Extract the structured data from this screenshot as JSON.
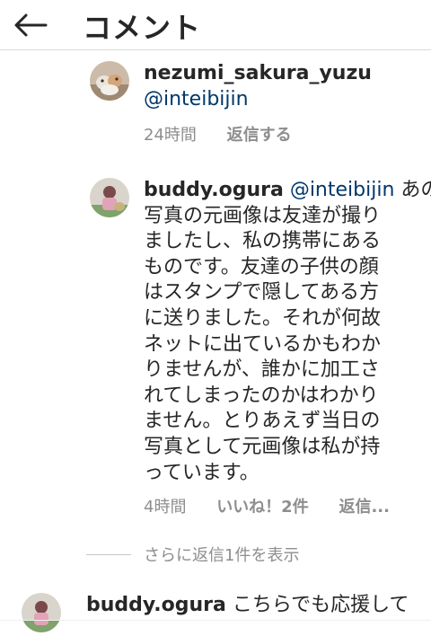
{
  "header": {
    "title": "コメント"
  },
  "comments": [
    {
      "username": "nezumi_sakura_yuzu",
      "mention": "@inteibijin",
      "text": "",
      "time": "24時間",
      "reply_label": "返信する"
    },
    {
      "username": "buddy.ogura",
      "mention": "@inteibijin",
      "text_lines": [
        "あの",
        "写真の元画像は友達が撮り",
        "ましたし、私の携帯にある",
        "ものです。友達の子供の顔",
        "はスタンプで隠してある方",
        "に送りました。それが何故",
        "ネットに出ているかもわか",
        "りませんが、誰かに加工さ",
        "れてしまったのかはわかり",
        "ません。とりあえず当日の",
        "写真として元画像は私が持",
        "っています。"
      ],
      "time": "4時間",
      "likes": "いいね！2件",
      "reply_label": "返信..."
    },
    {
      "username": "buddy.ogura",
      "text": "こちらでも応援して"
    }
  ],
  "more_replies": "さらに返信1件を表示",
  "colors": {
    "text": "#262626",
    "mention": "#00376b",
    "meta": "#8e8e8e",
    "divider": "#dbdbdb"
  }
}
